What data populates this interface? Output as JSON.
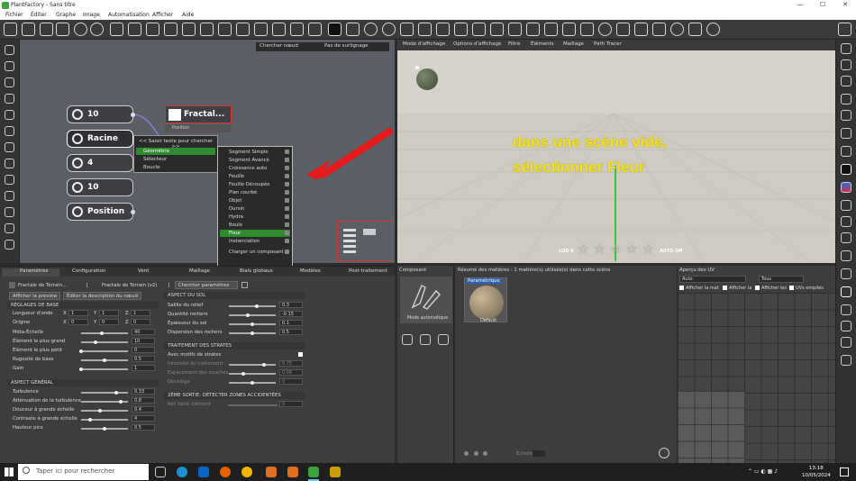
{
  "window": {
    "title": "PlantFactory - Sans titre",
    "min": "—",
    "max": "☐",
    "close": "✕"
  },
  "menu": [
    "Fichier",
    "Éditer",
    "Graphe",
    "Image",
    "Automatisation",
    "Afficher",
    "Aide"
  ],
  "node_editor": {
    "search_node": "Chercher nœud",
    "highlight": "Pas de surlignage",
    "nodes": [
      "10",
      "Racine",
      "4",
      "10",
      "Position"
    ],
    "fractal_node": {
      "label": "Fractal...",
      "port": "Position"
    },
    "context_menu": {
      "search_hint": "<< Saisir texte pour chercher >>",
      "items": [
        "Géométrie",
        "Sélecteur",
        "Boucle"
      ]
    },
    "submenu": [
      "Segment Simple",
      "Segment Avancé",
      "Croissance auto",
      "Feuille",
      "Feuille Découpée",
      "Plan courbé",
      "Objet",
      "Oursin",
      "Hydra",
      "Boule",
      "Fleur",
      "Instanciation",
      "Charger un composant"
    ],
    "submenu_highlight": "Fleur"
  },
  "viewport": {
    "menu": [
      "Mode d'affichage",
      "Options d'affichage",
      "Filtre",
      "Éléments",
      "Maillage",
      "Path Tracer"
    ],
    "annotation_line1": "dans une scène vide,",
    "annotation_line2": "sélectionner Fleur",
    "lod_label": "LOD 0",
    "auto_label": "AUTO Off",
    "colors": {
      "annotation": "#f5e21a",
      "arrow": "#e31b1b",
      "axis_green": "#3cc43c"
    }
  },
  "params": {
    "tabs": [
      "Paramètres",
      "Configuration",
      "Vent",
      "Maillage",
      "Biais globaux",
      "Modèles",
      "Post-traitement"
    ],
    "breadcrumb_node": "Fractale de Terrain...",
    "breadcrumb_type": "Fractale de Terrain (v2)",
    "search_params": "Chercher paramètres",
    "show_preview": "Afficher la preview",
    "edit_desc": "Éditer la description du nœud",
    "sec_base": "RÉGLAGES DE BASE",
    "longueur": {
      "label": "Longueur d'onde",
      "x": "1",
      "y": "1",
      "z": "1"
    },
    "origine": {
      "label": "Origine",
      "x": "0",
      "y": "0",
      "z": "0"
    },
    "rows_left_a": [
      {
        "label": "Méta-Échelle",
        "value": "40",
        "pos": 0.45
      },
      {
        "label": "Élément le plus grand",
        "value": "10",
        "pos": 0.3
      },
      {
        "label": "Élément le plus petit",
        "value": "0",
        "pos": 0.0
      },
      {
        "label": "Rugosité de base",
        "value": "0.5",
        "pos": 0.5
      },
      {
        "label": "Gain",
        "value": "1",
        "pos": 0.0
      }
    ],
    "sec_general": "ASPECT GÉNÉRAL",
    "rows_left_b": [
      {
        "label": "Turbulence",
        "value": "0.33",
        "pos": 0.75
      },
      {
        "label": "Atténuation de la turbulence",
        "value": "0.8",
        "pos": 0.85
      },
      {
        "label": "Douceur à grande échelle",
        "value": "0.4",
        "pos": 0.4
      },
      {
        "label": "Contraste à grande échelle",
        "value": "4",
        "pos": 0.2
      },
      {
        "label": "Hauteur pics",
        "value": "0.5",
        "pos": 0.5
      }
    ],
    "sec_sol": "ASPECT DU SOL",
    "rows_right_a": [
      {
        "label": "Saillie du relief",
        "value": "0.3",
        "pos": 0.6
      },
      {
        "label": "Quantité rochers",
        "value": "-0.15",
        "pos": 0.4
      },
      {
        "label": "Épaisseur du sol",
        "value": "0.1",
        "pos": 0.5
      },
      {
        "label": "Dispersion des rochers",
        "value": "0.5",
        "pos": 0.5
      }
    ],
    "sec_strates": "TRAITEMENT DES STRATES",
    "avec_motifs": "Avec motifs de strates",
    "rows_right_b": [
      {
        "label": "Intensité du traitement",
        "value": "0.75",
        "pos": 0.75
      },
      {
        "label": "Espacement des couches",
        "value": "0.06",
        "pos": 0.3
      },
      {
        "label": "Décalage",
        "value": "0",
        "pos": 0.5
      }
    ],
    "sec_zones": "2ÈME SORTIE: DÉTECTER ZONES ACCIDENTÉES",
    "ref_taille": {
      "label": "Réf. taille élément",
      "value": "0"
    }
  },
  "composant": {
    "title": "Composant",
    "mode": "Mode automatique"
  },
  "materials": {
    "summary": "Résumé des matières : 1 matière(s) utilisée(s) dans cette scène",
    "mat_tag": "Paramétrique",
    "mat_name": "Default",
    "scale_label": "Échelle"
  },
  "uv": {
    "title": "Aperçu des UV",
    "dropdown1": "Auto",
    "dropdown2": "Tous",
    "checks": [
      "Afficher la mat",
      "Afficher la",
      "Afficher les",
      "UVs empilés"
    ]
  },
  "taskbar": {
    "search": "Taper ici pour rechercher",
    "time": "13:18",
    "date": "10/05/2024"
  }
}
